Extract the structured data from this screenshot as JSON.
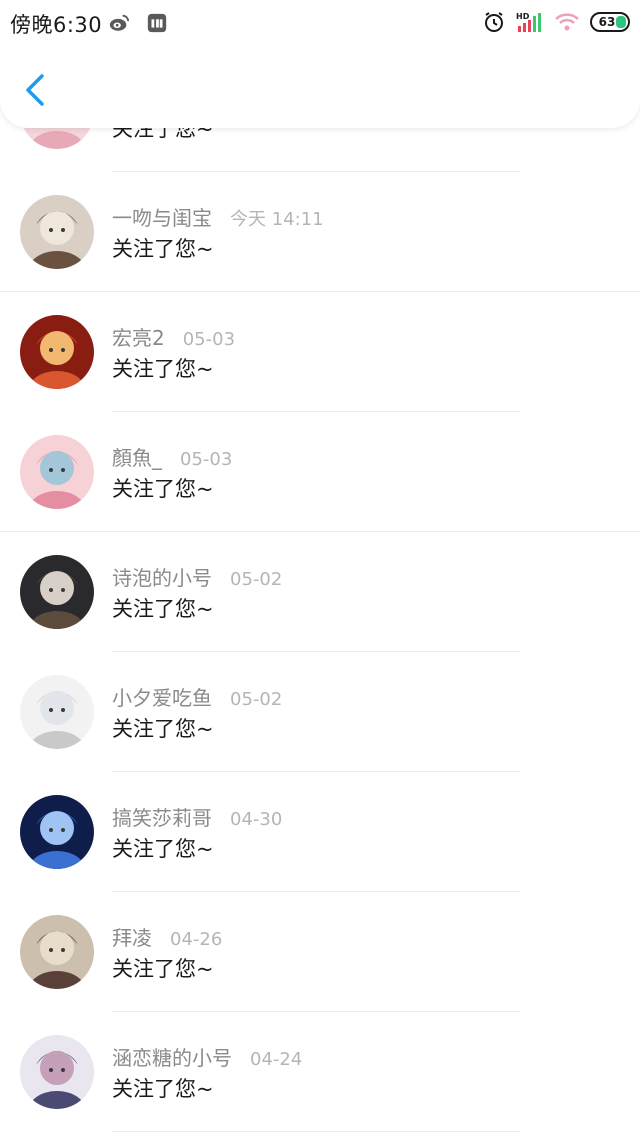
{
  "status_bar": {
    "time": "傍晚6:30",
    "battery": "63",
    "network_label": "HD",
    "icons": [
      "weibo-icon",
      "mi-icon",
      "alarm-icon",
      "signal-icon",
      "wifi-icon",
      "battery-icon"
    ]
  },
  "header": {
    "back_icon": "chevron-left-icon",
    "accent_color": "#1e9bec"
  },
  "notifications": [
    {
      "name": "",
      "date": "",
      "message": "关注了您~",
      "separator": "short",
      "avatar_colors": [
        "#f4d6dc",
        "#e8a9b6",
        "#fff3f4"
      ]
    },
    {
      "name": "一吻与闺宝",
      "date": "今天 14:11",
      "message": "关注了您~",
      "separator": "full",
      "avatar_colors": [
        "#d9cfc4",
        "#6b5140",
        "#efe7db"
      ]
    },
    {
      "name": "宏亮2",
      "date": "05-03",
      "message": "关注了您~",
      "separator": "short",
      "avatar_colors": [
        "#8a1d12",
        "#d9572f",
        "#f3b870"
      ]
    },
    {
      "name": "顏魚_",
      "date": "05-03",
      "message": "关注了您~",
      "separator": "full",
      "avatar_colors": [
        "#f6d1d6",
        "#e58ea1",
        "#a3c6d9"
      ]
    },
    {
      "name": "诗泡的小号",
      "date": "05-02",
      "message": "关注了您~",
      "separator": "short",
      "avatar_colors": [
        "#2a2a2e",
        "#5c4a3d",
        "#d8d0c8"
      ]
    },
    {
      "name": "小夕爱吃鱼",
      "date": "05-02",
      "message": "关注了您~",
      "separator": "short",
      "avatar_colors": [
        "#f2f2f2",
        "#c9c9c9",
        "#e2e6ea"
      ]
    },
    {
      "name": "搞笑莎莉哥",
      "date": "04-30",
      "message": "关注了您~",
      "separator": "short",
      "avatar_colors": [
        "#0f1d4a",
        "#3b6fd1",
        "#9fc3f2"
      ]
    },
    {
      "name": "拜凌",
      "date": "04-26",
      "message": "关注了您~",
      "separator": "short",
      "avatar_colors": [
        "#cdbfae",
        "#5a4038",
        "#e8dccb"
      ]
    },
    {
      "name": "涵恋糖的小号",
      "date": "04-24",
      "message": "关注了您~",
      "separator": "short",
      "avatar_colors": [
        "#e9e6ef",
        "#4b4a72",
        "#c6a0b9"
      ]
    }
  ]
}
